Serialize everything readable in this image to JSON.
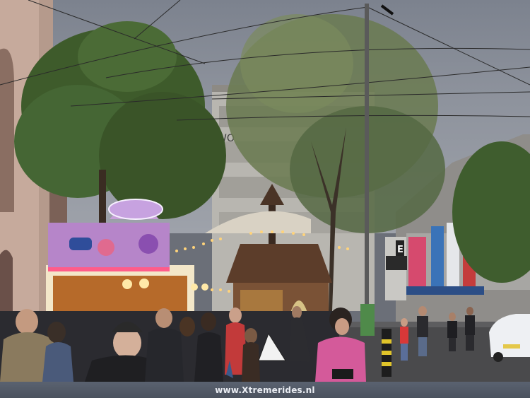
{
  "scene": {
    "description_colors": {
      "sky": "#8d929c",
      "tree": "#3f5a2a",
      "booth": "#b27fc8",
      "street": "#4a4a4c",
      "lights": "#ffd37a"
    }
  },
  "signs": {
    "carousel_top": "",
    "booth_badge": "",
    "building_letters": "WO",
    "shop_letter": "E"
  },
  "caption": {
    "text": "www.Xtremerides.nl"
  }
}
